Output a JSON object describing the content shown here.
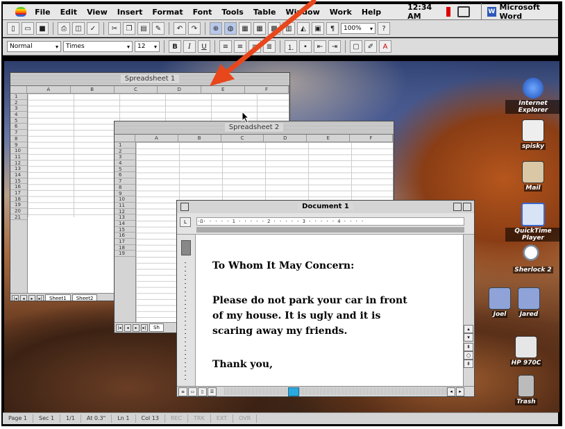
{
  "menubar": {
    "items": [
      "File",
      "Edit",
      "View",
      "Insert",
      "Format",
      "Font",
      "Tools",
      "Table",
      "Window",
      "Work",
      "Help"
    ],
    "clock": "12:34 AM",
    "app_name": "Microsoft Word"
  },
  "toolbar": {
    "style": "Normal",
    "font": "Times",
    "size": "12",
    "zoom": "100%",
    "bold": "B",
    "italic": "I",
    "underline": "U",
    "pilcrow": "¶"
  },
  "spreadsheet1": {
    "title": "Spreadsheet 1",
    "columns": [
      "A",
      "B",
      "C",
      "D",
      "E",
      "F"
    ],
    "rows": [
      "1",
      "2",
      "3",
      "4",
      "5",
      "6",
      "7",
      "8",
      "9",
      "10",
      "11",
      "12",
      "13",
      "14",
      "15",
      "16",
      "17",
      "18",
      "19",
      "20",
      "21"
    ],
    "tabs": [
      "Sheet1",
      "Sheet2"
    ]
  },
  "spreadsheet2": {
    "title": "Spreadsheet 2",
    "columns": [
      "A",
      "B",
      "C",
      "D",
      "E",
      "F"
    ],
    "rows": [
      "1",
      "2",
      "3",
      "4",
      "5",
      "6",
      "7",
      "8",
      "9",
      "10",
      "11",
      "12",
      "13",
      "14",
      "15",
      "16",
      "17",
      "18",
      "19"
    ],
    "tabs": [
      "Sh"
    ]
  },
  "document": {
    "title": "Document 1",
    "ruler_text": "·Ω· · · · · 1 · · · · · 2 · · · · · 3 · · · · · 4 · · · ·",
    "lines": [
      "To Whom It May Concern:",
      "Please do not park your car in front",
      "of my house. It is ugly and it is",
      "scaring away my friends.",
      "Thank you,"
    ]
  },
  "desktop_icons": [
    {
      "label": "Internet Explorer",
      "icon": "globe-icon",
      "color": "#2a6bd8"
    },
    {
      "label": "spisky",
      "icon": "person-icon",
      "color": "#eeeeee"
    },
    {
      "label": "Mail",
      "icon": "mail-icon",
      "color": "#d9c7a6"
    },
    {
      "label": "QuickTime Player",
      "icon": "quicktime-icon",
      "color": "#3a68d0"
    },
    {
      "label": "Sherlock 2",
      "icon": "magnifier-icon",
      "color": "#c9d8ea"
    },
    {
      "label": "Joel",
      "icon": "folder-icon",
      "color": "#8fa3d8"
    },
    {
      "label": "Jared",
      "icon": "folder-icon",
      "color": "#8fa3d8"
    },
    {
      "label": "HP 970C",
      "icon": "printer-icon",
      "color": "#e6e6e6"
    },
    {
      "label": "Trash",
      "icon": "trash-icon",
      "color": "#bbbbbb"
    }
  ],
  "statusbar": {
    "page": "Page 1",
    "sec": "Sec 1",
    "pages": "1/1",
    "at": "At 0.3\"",
    "ln": "Ln 1",
    "col": "Col 13",
    "modes": [
      "REC",
      "TRK",
      "EXT",
      "OVR"
    ]
  },
  "annotation": {
    "arrow_color": "#e8471c"
  }
}
